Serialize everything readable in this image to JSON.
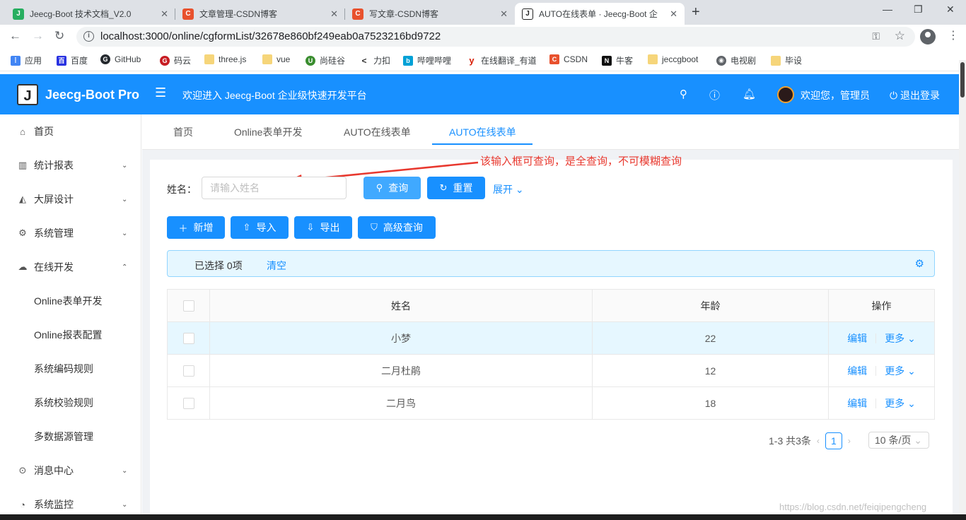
{
  "browser": {
    "tabs": [
      {
        "title": "Jeecg-Boot 技术文档_V2.0",
        "color": "#27ae60",
        "glyph": "J"
      },
      {
        "title": "文章管理-CSDN博客",
        "color": "#e8512d",
        "glyph": "C"
      },
      {
        "title": "写文章-CSDN博客",
        "color": "#e8512d",
        "glyph": "C"
      },
      {
        "title": "AUTO在线表单 · Jeecg-Boot 企",
        "color": "#222222",
        "glyph": "J"
      }
    ],
    "url": "localhost:3000/online/cgformList/32678e860bf249eab0a7523216bd9722",
    "bookmarks": [
      "应用",
      "百度",
      "GitHub",
      "码云",
      "three.js",
      "vue",
      "尚硅谷",
      "力扣",
      "哔哩哔哩",
      "在线翻译_有道",
      "CSDN",
      "牛客",
      "jeccgboot",
      "电视剧",
      "毕设"
    ]
  },
  "header": {
    "logo": "Jeecg-Boot Pro",
    "welcome": "欢迎进入 Jeecg-Boot 企业级快速开发平台",
    "user": "欢迎您，管理员",
    "logout": "退出登录"
  },
  "sidebar": {
    "items": [
      {
        "label": "首页",
        "icon": "home-icon"
      },
      {
        "label": "统计报表",
        "icon": "chart-icon"
      },
      {
        "label": "大屏设计",
        "icon": "area-chart-icon"
      },
      {
        "label": "系统管理",
        "icon": "setting-icon"
      },
      {
        "label": "在线开发",
        "icon": "cloud-icon"
      },
      {
        "label": "Online表单开发"
      },
      {
        "label": "Online报表配置"
      },
      {
        "label": "系统编码规则"
      },
      {
        "label": "系统校验规则"
      },
      {
        "label": "多数据源管理"
      },
      {
        "label": "消息中心",
        "icon": "message-icon"
      },
      {
        "label": "系统监控",
        "icon": "dashboard-icon"
      }
    ]
  },
  "page_tabs": [
    "首页",
    "Online表单开发",
    "AUTO在线表单",
    "AUTO在线表单"
  ],
  "annotation": "该输入框可查询，是全查询，不可模糊查询",
  "query": {
    "label": "姓名：",
    "placeholder": "请输入姓名",
    "search": "查询",
    "reset": "重置",
    "expand": "展开"
  },
  "toolbar": {
    "add": "新增",
    "import": "导入",
    "export": "导出",
    "advanced": "高级查询"
  },
  "selection": {
    "prefix": "已选择",
    "count": "0",
    "suffix": "项",
    "clear": "清空"
  },
  "table": {
    "columns": [
      "姓名",
      "年龄",
      "操作"
    ],
    "rows": [
      {
        "name": "小梦",
        "age": "22"
      },
      {
        "name": "二月杜鹃",
        "age": "12"
      },
      {
        "name": "二月鸟",
        "age": "18"
      }
    ],
    "edit": "编辑",
    "more": "更多"
  },
  "pagination": {
    "total": "1-3 共3条",
    "current": "1",
    "page_size": "10 条/页"
  },
  "watermark": "https://blog.csdn.net/feiqipengcheng",
  "colors": {
    "primary": "#1890ff",
    "annotation": "#e8382e"
  }
}
